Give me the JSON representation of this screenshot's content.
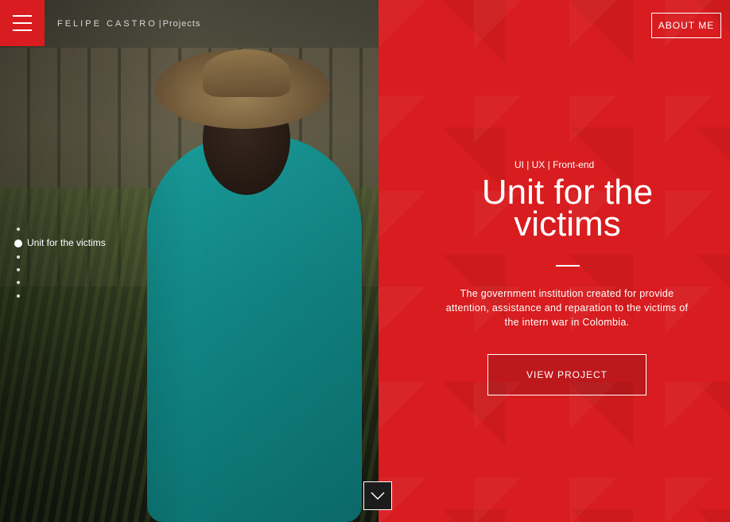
{
  "brand": {
    "name": "FELIPE CASTRO",
    "separator": "|",
    "section": "Projects"
  },
  "header": {
    "about_label": "ABOUT ME"
  },
  "nav": {
    "active_label": "Unit for the victims",
    "dot_count": 6,
    "active_index": 0
  },
  "project": {
    "tags": "UI | UX | Front-end",
    "title_line1": "Unit for the",
    "title_line2": "victims",
    "description": "The government institution created for provide attention, assistance and reparation to the victims of the intern war in Colombia.",
    "cta_label": "VIEW PROJECT"
  },
  "icons": {
    "menu": "hamburger-icon",
    "scroll": "chevron-down-icon"
  },
  "colors": {
    "accent": "#d81c1f",
    "photo_teal": "#1aa2a0"
  }
}
